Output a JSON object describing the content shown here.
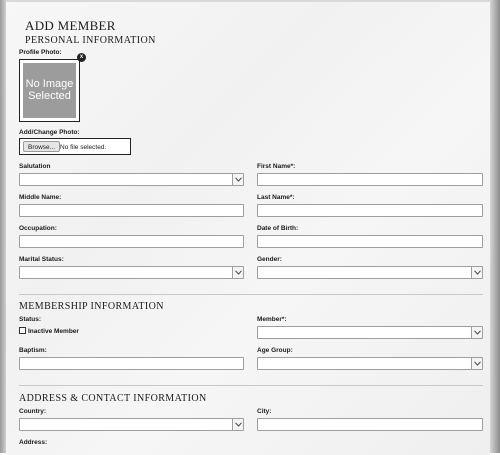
{
  "form": {
    "title": "ADD MEMBER",
    "personal": {
      "section_title": "PERSONAL INFORMATION",
      "profile_photo_label": "Profile Photo:",
      "no_image_text": "No Image Selected",
      "remove_icon": "x",
      "add_change_photo_label": "Add/Change Photo:",
      "browse_label": "Browse...",
      "file_status": "No file selected.",
      "salutation_label": "Salutation",
      "salutation_value": "",
      "first_name_label": "First Name*:",
      "first_name_value": "",
      "middle_name_label": "Middle Name:",
      "middle_name_value": "",
      "last_name_label": "Last Name*:",
      "last_name_value": "",
      "occupation_label": "Occupation:",
      "occupation_value": "",
      "dob_label": "Date of Birth:",
      "dob_value": "",
      "marital_status_label": "Marital Status:",
      "marital_status_value": "",
      "gender_label": "Gender:",
      "gender_value": ""
    },
    "membership": {
      "section_title": "MEMBERSHIP INFORMATION",
      "status_label": "Status:",
      "inactive_label": "Inactive Member",
      "inactive_checked": false,
      "member_label": "Member*:",
      "member_value": "",
      "baptism_label": "Baptism:",
      "baptism_value": "",
      "age_group_label": "Age Group:",
      "age_group_value": ""
    },
    "address": {
      "section_title": "ADDRESS & CONTACT INFORMATION",
      "country_label": "Country:",
      "country_value": "",
      "city_label": "City:",
      "city_value": "",
      "address_label": "Address:"
    }
  },
  "icons": {
    "dropdown": "chevron-down-icon",
    "remove_photo": "close-icon"
  },
  "colors": {
    "background": "#f4f4f4",
    "border": "#9e9e9e",
    "photo_placeholder": "#9c9c9c",
    "text": "#1a1a1a"
  }
}
